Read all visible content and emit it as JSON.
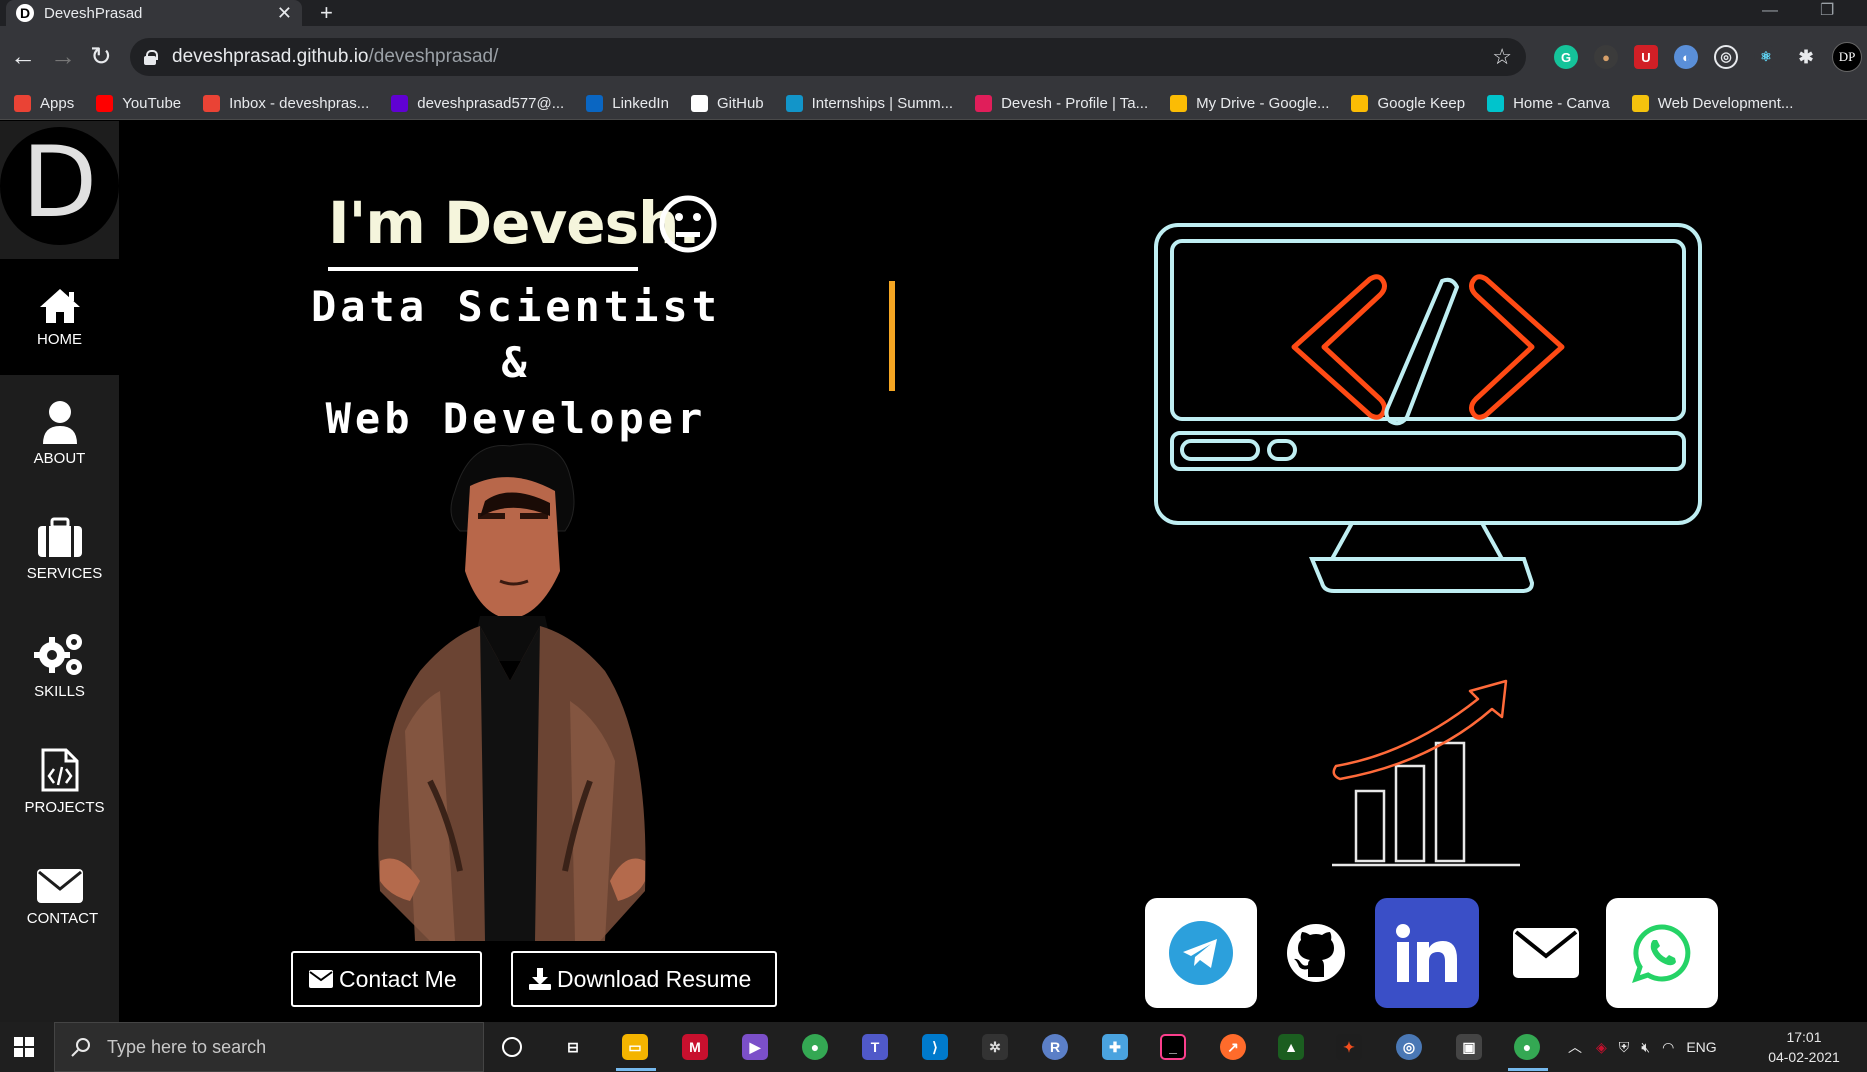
{
  "browser": {
    "tab_title": "DeveshPrasad",
    "tab_favicon": "D",
    "url_host": "deveshprasad.github.io",
    "url_path": "/deveshprasad/",
    "profile_initials": "DP",
    "bookmarks": [
      {
        "label": "Apps",
        "icon": "apps-grid-icon",
        "color": "#ea4335"
      },
      {
        "label": "YouTube",
        "icon": "youtube-icon",
        "color": "#ff0000"
      },
      {
        "label": "Inbox - deveshpras...",
        "icon": "gmail-icon",
        "color": "#ea4335"
      },
      {
        "label": "deveshprasad577@...",
        "icon": "yahoo-mail-icon",
        "color": "#6001d2"
      },
      {
        "label": "LinkedIn",
        "icon": "linkedin-icon",
        "color": "#0a66c2"
      },
      {
        "label": "GitHub",
        "icon": "github-icon",
        "color": "#ffffff"
      },
      {
        "label": "Internships | Summ...",
        "icon": "internshala-icon",
        "color": "#1295c9"
      },
      {
        "label": "Devesh - Profile | Ta...",
        "icon": "slack-icon",
        "color": "#e01e5a"
      },
      {
        "label": "My Drive - Google...",
        "icon": "google-drive-icon",
        "color": "#fbbc04"
      },
      {
        "label": "Google Keep",
        "icon": "google-keep-icon",
        "color": "#fbbc04"
      },
      {
        "label": "Home - Canva",
        "icon": "canva-icon",
        "color": "#00c4cc"
      },
      {
        "label": "Web Development...",
        "icon": "web-dev-icon",
        "color": "#f4c20d"
      }
    ]
  },
  "sidebar": {
    "logo_letter": "D",
    "items": [
      {
        "label": "HOME",
        "icon": "home-icon"
      },
      {
        "label": "ABOUT",
        "icon": "user-icon"
      },
      {
        "label": "SERVICES",
        "icon": "briefcase-icon"
      },
      {
        "label": "SKILLS",
        "icon": "gears-icon"
      },
      {
        "label": "PROJECTS",
        "icon": "code-file-icon"
      },
      {
        "label": "CONTACT",
        "icon": "envelope-icon"
      }
    ]
  },
  "hero": {
    "name": "I'm Devesh.",
    "role_line1": "Data Scientist &",
    "role_line2": "Web Developer",
    "contact_button": "Contact Me",
    "resume_button": "Download Resume"
  },
  "social": [
    {
      "name": "telegram",
      "bg": "#ffffff"
    },
    {
      "name": "github",
      "bg": "#000000"
    },
    {
      "name": "linkedin",
      "bg": "#3a4fc7"
    },
    {
      "name": "email",
      "bg": "#000000"
    },
    {
      "name": "whatsapp",
      "bg": "#ffffff"
    }
  ],
  "taskbar": {
    "search_placeholder": "Type here to search",
    "language": "ENG",
    "time": "17:01",
    "date": "04-02-2021"
  }
}
